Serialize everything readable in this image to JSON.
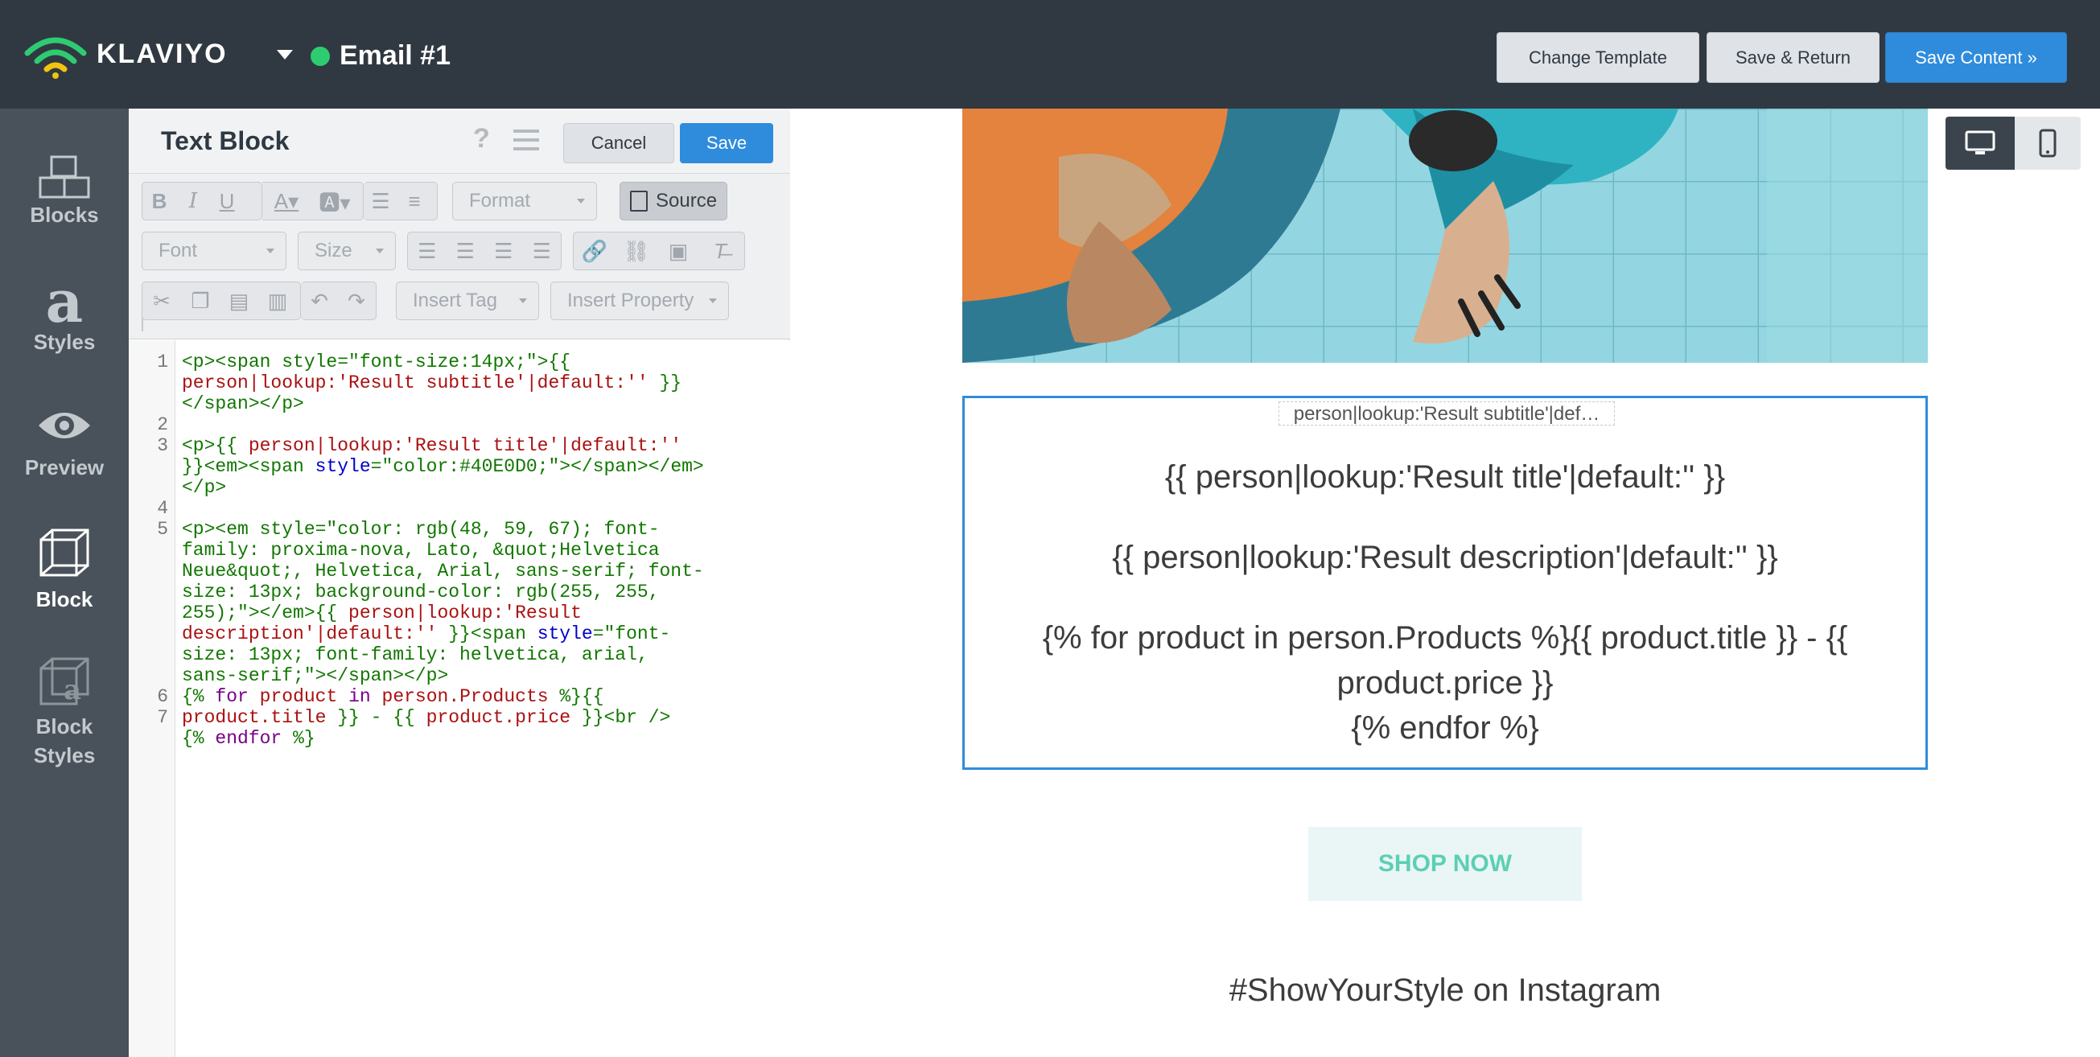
{
  "header": {
    "logo_text": "KLAVIYO",
    "email_title": "Email #1",
    "status_color": "#2ecc71",
    "buttons": {
      "change_template": "Change Template",
      "save_return": "Save & Return",
      "save_content": "Save Content »"
    }
  },
  "sidebar": {
    "items": [
      {
        "label": "Blocks",
        "icon": "blocks-icon",
        "active": false
      },
      {
        "label": "Styles",
        "icon": "styles-icon",
        "active": false
      },
      {
        "label": "Preview",
        "icon": "eye-icon",
        "active": false
      },
      {
        "label": "Block",
        "icon": "cube-icon",
        "active": true
      },
      {
        "label_line1": "Block",
        "label_line2": "Styles",
        "icon": "block-styles-icon",
        "active": false
      }
    ]
  },
  "editor": {
    "title": "Text Block",
    "cancel": "Cancel",
    "save": "Save",
    "toolbar": {
      "format": "Format",
      "source": "Source",
      "font": "Font",
      "size": "Size",
      "insert_tag": "Insert Tag",
      "insert_property": "Insert Property"
    },
    "line_numbers": [
      "1",
      "2",
      "3",
      "4",
      "5",
      "6",
      "7"
    ]
  },
  "preview": {
    "subtitle_chip": "person|lookup:'Result subtitle'|def…",
    "title_line": "{{ person|lookup:'Result title'|default:'' }}",
    "desc_line": "{{ person|lookup:'Result description'|default:'' }}",
    "loop_line1": "{% for product in person.Products %}{{ product.title }} - {{",
    "loop_line2": "product.price }}",
    "loop_line3": "{% endfor %}",
    "shop_now": "SHOP NOW",
    "instagram": "#ShowYourStyle on Instagram"
  },
  "colors": {
    "topbar": "#303941",
    "sidebar": "#49525a",
    "accent_blue": "#2f8cdd",
    "shop_now_text": "#5ccfb4",
    "shop_now_bg": "#eaf6f5"
  }
}
